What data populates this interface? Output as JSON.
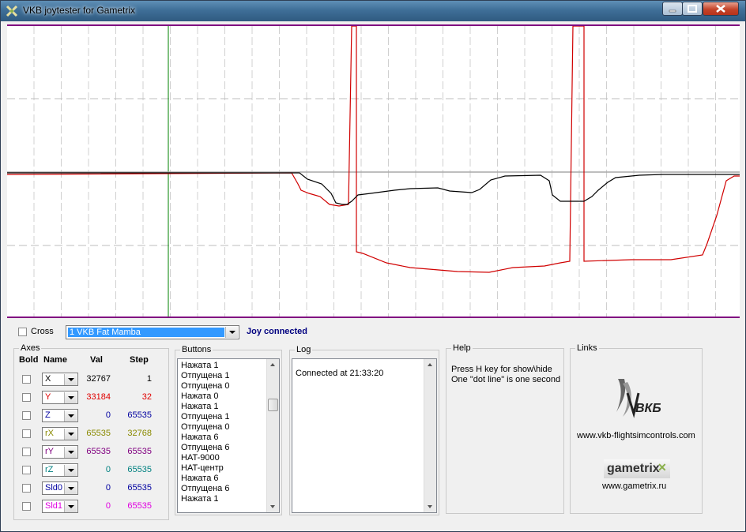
{
  "window": {
    "title": "VKB joytester for Gametrix"
  },
  "top": {
    "cross_label": "Cross",
    "device_selected": "1 VKB Fat Mamba",
    "status": "Joy connected"
  },
  "axes": {
    "title": "Axes",
    "headers": {
      "bold": "Bold",
      "name": "Name",
      "val": "Val",
      "step": "Step"
    },
    "rows": [
      {
        "name": "X",
        "val": "32767",
        "step": "1",
        "color": "#000000"
      },
      {
        "name": "Y",
        "val": "33184",
        "step": "32",
        "color": "#e00000"
      },
      {
        "name": "Z",
        "val": "0",
        "step": "65535",
        "color": "#0000a0"
      },
      {
        "name": "rX",
        "val": "65535",
        "step": "32768",
        "color": "#8a8a00"
      },
      {
        "name": "rY",
        "val": "65535",
        "step": "65535",
        "color": "#800080"
      },
      {
        "name": "rZ",
        "val": "0",
        "step": "65535",
        "color": "#008080"
      },
      {
        "name": "Sld0",
        "val": "0",
        "step": "65535",
        "color": "#0000a0"
      },
      {
        "name": "Sld1",
        "val": "0",
        "step": "65535",
        "color": "#e000e0"
      }
    ]
  },
  "buttons": {
    "title": "Buttons",
    "items": [
      "Нажата 1",
      "Отпущена 1",
      "Отпущена 0",
      "Нажата 0",
      "Нажата 1",
      "Отпущена 1",
      "Отпущена 0",
      "Нажата 6",
      "Отпущена 6",
      "HAT-9000",
      "HAT-центр",
      "Нажата 6",
      "Отпущена 6",
      "Нажата 1"
    ]
  },
  "log": {
    "title": "Log",
    "items": [
      "Connected at 21:33:20"
    ]
  },
  "help": {
    "title": "Help",
    "line1": "Press H key for show\\hide",
    "line2": "One \"dot line\" is one second"
  },
  "links": {
    "title": "Links",
    "vkb_logo_text": "ВКБ",
    "vkb_url": "www.vkb-flightsimcontrols.com",
    "gametrix_logo_text": "gametrix",
    "gametrix_url": "www.gametrix.ru"
  },
  "colors": {
    "accent_blue": "#000080",
    "graph_border": "#800080",
    "grid": "#c0c0c0"
  }
}
